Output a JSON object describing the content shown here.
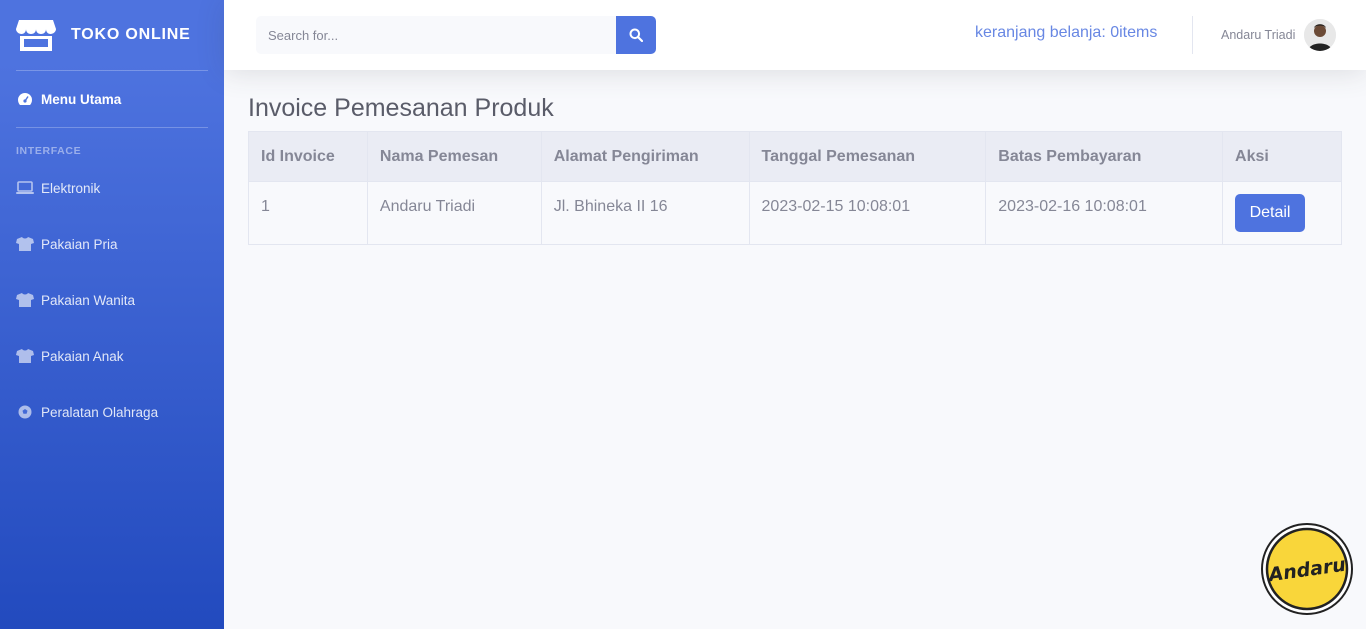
{
  "brand": {
    "name": "TOKO ONLINE"
  },
  "sidebar": {
    "main_item": "Menu Utama",
    "heading": "INTERFACE",
    "items": [
      {
        "label": "Elektronik",
        "icon": "laptop-icon"
      },
      {
        "label": "Pakaian Pria",
        "icon": "tshirt-icon"
      },
      {
        "label": "Pakaian Wanita",
        "icon": "tshirt-icon"
      },
      {
        "label": "Pakaian Anak",
        "icon": "tshirt-icon"
      },
      {
        "label": "Peralatan Olahraga",
        "icon": "football-icon"
      }
    ]
  },
  "topbar": {
    "search_placeholder": "Search for...",
    "cart_text": "keranjang belanja: 0items",
    "user_name": "Andaru Triadi"
  },
  "main": {
    "title": "Invoice Pemesanan Produk",
    "table": {
      "headers": [
        "Id Invoice",
        "Nama Pemesan",
        "Alamat Pengiriman",
        "Tanggal Pemesanan",
        "Batas Pembayaran",
        "Aksi"
      ],
      "rows": [
        {
          "id": "1",
          "nama": "Andaru Triadi",
          "alamat": "Jl. Bhineka II 16",
          "tanggal": "2023-02-15 10:08:01",
          "batas": "2023-02-16 10:08:01",
          "aksi": "Detail"
        }
      ]
    }
  },
  "watermark": {
    "text": "Andaru"
  },
  "colors": {
    "primary": "#4e73df",
    "primary_dark": "#224abe",
    "text_muted": "#858796",
    "badge_yellow": "#f9d63a"
  }
}
